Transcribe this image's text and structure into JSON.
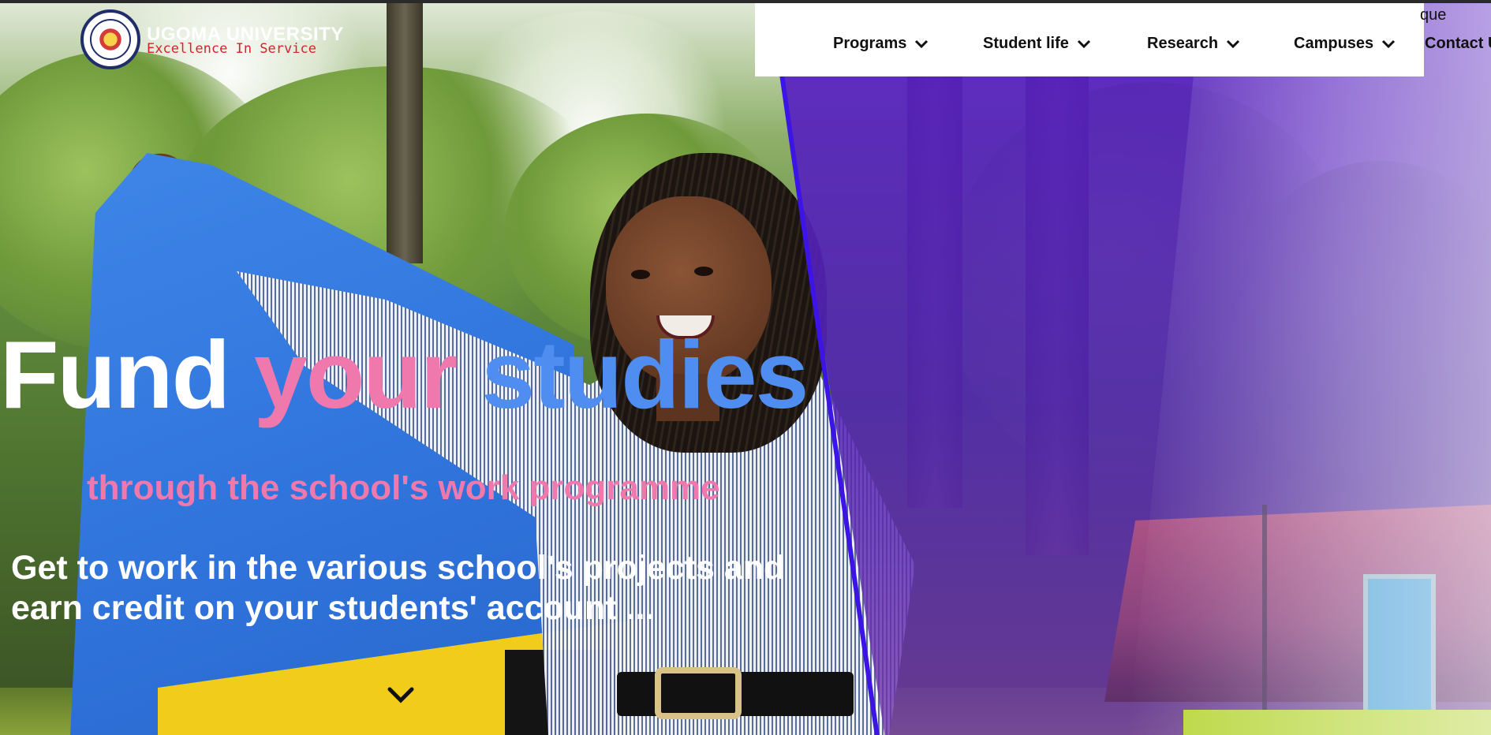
{
  "brand": {
    "name": "UGOMA UNIVERSITY",
    "tagline": "Excellence In Service"
  },
  "nav": {
    "items": [
      {
        "label": "Programs",
        "icon": "chevron-down-icon"
      },
      {
        "label": "Student life",
        "icon": "chevron-down-icon"
      },
      {
        "label": "Research",
        "icon": "chevron-down-icon"
      },
      {
        "label": "Campuses",
        "icon": "chevron-down-icon"
      },
      {
        "label": "Contact Us",
        "icon": "chevron-down-icon"
      }
    ],
    "language_fragment": "que"
  },
  "hero": {
    "title_word1": "Fund",
    "title_word2": "your",
    "title_word3": "studies",
    "subtitle": "through the school's work programme",
    "description": "Get to work in the various school's projects and earn credit on your students' account ...",
    "scroll_icon": "chevron-down-icon"
  },
  "colors": {
    "accent_pink": "#ef79ad",
    "accent_blue": "#4f8ef0",
    "overlay_purple": "#581ec4",
    "brand_red": "#d4242b"
  }
}
